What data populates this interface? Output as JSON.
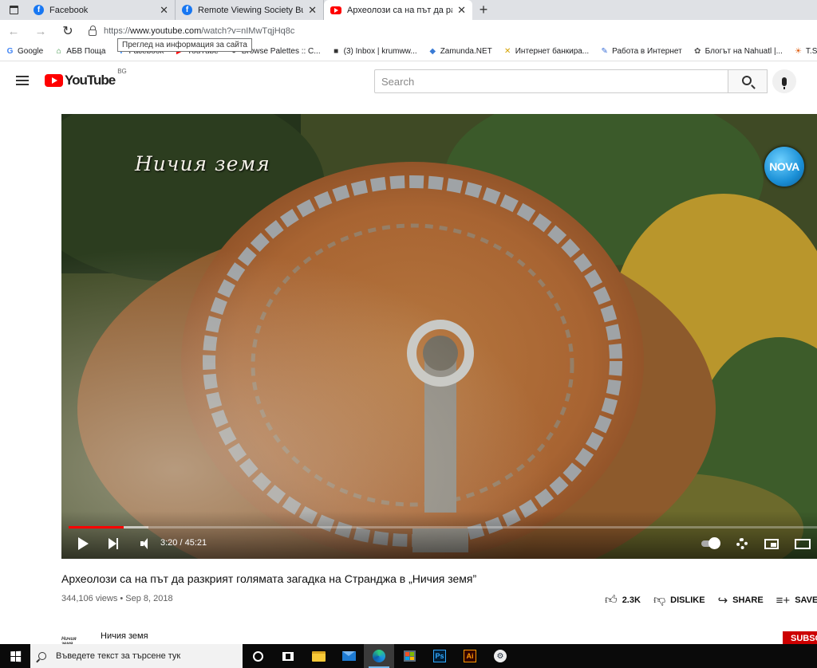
{
  "browser": {
    "tabs": [
      {
        "title": "Facebook",
        "icon": "facebook-icon",
        "active": false
      },
      {
        "title": "Remote Viewing Society Bulgaria",
        "icon": "facebook-icon",
        "active": false
      },
      {
        "title": "Археолози са на път да разкрият",
        "icon": "youtube-icon",
        "active": true
      }
    ],
    "new_tab_label": "+",
    "url_prefix": "https://",
    "url_host": "www.youtube.com",
    "url_path": "/watch?v=nIMwTqjHq8c",
    "tooltip": "Преглед на информация за сайта",
    "bookmarks": [
      {
        "label": "Google",
        "icon": "G",
        "color": "#4285f4"
      },
      {
        "label": "АБВ Поща",
        "icon": "⌂",
        "color": "#2e8b3a"
      },
      {
        "label": "Facebook",
        "icon": "f",
        "color": "#1877f2"
      },
      {
        "label": "YouTube",
        "icon": "▶",
        "color": "#ff0000"
      },
      {
        "label": "Browse Palettes :: C...",
        "icon": "●",
        "color": "#555555"
      },
      {
        "label": "(3) Inbox | krumww...",
        "icon": "■",
        "color": "#333333"
      },
      {
        "label": "Zamunda.NET",
        "icon": "◆",
        "color": "#3a7bd5"
      },
      {
        "label": "Интернет банкира...",
        "icon": "✕",
        "color": "#d4a200"
      },
      {
        "label": "Работа в Интернет",
        "icon": "✎",
        "color": "#3a6fd8"
      },
      {
        "label": "Блогът на Nahuatl |...",
        "icon": "✿",
        "color": "#555555"
      },
      {
        "label": "T.S. Wittelsbach",
        "icon": "☀",
        "color": "#e0641a"
      }
    ]
  },
  "youtube": {
    "logo_text": "YouTube",
    "country_code": "BG",
    "search_placeholder": "Search",
    "video": {
      "overlay_title": "Ничия земя",
      "channel_logo": "NOVA",
      "current_time": "3:20",
      "duration": "45:21",
      "played_fraction": 0.0735,
      "buffered_fraction": 0.107
    },
    "title": "Археолози са на път да разкрият голямата загадка на Странджа в „Ничия земя”",
    "views": "344,106 views",
    "date": "Sep 8, 2018",
    "actions": {
      "like_count": "2.3K",
      "dislike_label": "DISLIKE",
      "share_label": "SHARE",
      "save_label": "SAVE"
    },
    "channel_name": "Ничия земя",
    "channel_small_label": "Ничия земя",
    "subscribe_label": "SUBSCRIBE"
  },
  "taskbar": {
    "search_placeholder": "Въведете текст за търсене тук",
    "ps_label": "Ps",
    "ai_label": "Ai"
  }
}
